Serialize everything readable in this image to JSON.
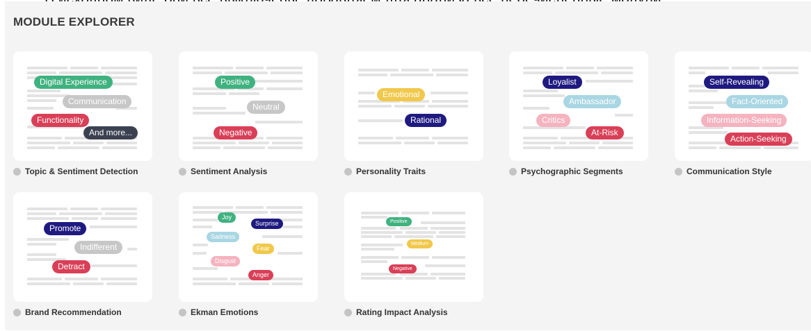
{
  "caption": "В исходном виде они все выключены, добавляем для анализа все перечисленные модули.",
  "panel": {
    "title": "MODULE EXPLORER"
  },
  "colors": {
    "green": "#3fb27f",
    "gray": "#c7c7c7",
    "red": "#d93f57",
    "navy": "#1f1a80",
    "dark": "#3b4150",
    "yellow": "#f1c84b",
    "lightblue": "#a9d6e3",
    "pink": "#f5b3bf",
    "dot_off": "#c4c4c4"
  },
  "modules": [
    {
      "label": "Topic & Sentiment Detection",
      "status": "off",
      "chips": [
        {
          "text": "Digital Experience",
          "color": "green"
        },
        {
          "text": "Communication",
          "color": "gray"
        },
        {
          "text": "Functionality",
          "color": "red"
        },
        {
          "text": "And more...",
          "color": "dark"
        }
      ]
    },
    {
      "label": "Sentiment Analysis",
      "status": "off",
      "chips": [
        {
          "text": "Positive",
          "color": "green"
        },
        {
          "text": "Neutral",
          "color": "gray"
        },
        {
          "text": "Negative",
          "color": "red"
        }
      ]
    },
    {
      "label": "Personality Traits",
      "status": "off",
      "chips": [
        {
          "text": "Emotional",
          "color": "yellow"
        },
        {
          "text": "Rational",
          "color": "navy"
        }
      ]
    },
    {
      "label": "Psychographic Segments",
      "status": "off",
      "chips": [
        {
          "text": "Loyalist",
          "color": "navy"
        },
        {
          "text": "Ambassador",
          "color": "lightblue"
        },
        {
          "text": "Critics",
          "color": "pink"
        },
        {
          "text": "At-Risk",
          "color": "red"
        }
      ]
    },
    {
      "label": "Communication Style",
      "status": "off",
      "chips": [
        {
          "text": "Self-Revealing",
          "color": "navy"
        },
        {
          "text": "Fact-Oriented",
          "color": "lightblue"
        },
        {
          "text": "Information-Seeking",
          "color": "pink"
        },
        {
          "text": "Action-Seeking",
          "color": "red"
        }
      ]
    },
    {
      "label": "Brand Recommendation",
      "status": "off",
      "chips": [
        {
          "text": "Promote",
          "color": "navy"
        },
        {
          "text": "Indifferent",
          "color": "gray"
        },
        {
          "text": "Detract",
          "color": "red"
        }
      ]
    },
    {
      "label": "Ekman Emotions",
      "status": "off",
      "chips": [
        {
          "text": "Joy",
          "color": "green"
        },
        {
          "text": "Surprise",
          "color": "navy"
        },
        {
          "text": "Sadness",
          "color": "lightblue"
        },
        {
          "text": "Fear",
          "color": "yellow"
        },
        {
          "text": "Disgust",
          "color": "pink"
        },
        {
          "text": "Anger",
          "color": "red"
        }
      ]
    },
    {
      "label": "Rating Impact Analysis",
      "status": "off",
      "chips": [
        {
          "text": "Positive",
          "color": "green"
        },
        {
          "text": "Medium",
          "color": "yellow"
        },
        {
          "text": "Negative",
          "color": "red"
        }
      ]
    }
  ]
}
